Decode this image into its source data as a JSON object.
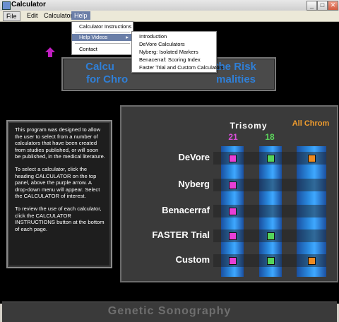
{
  "window": {
    "title": "Calculator"
  },
  "menubar": {
    "items": [
      "File",
      "Edit",
      "Calculator",
      "Help"
    ]
  },
  "help_menu": {
    "items": [
      "Calculator Instructions",
      "Help Videos",
      "Contact"
    ],
    "submenu_arrow": "▸"
  },
  "help_videos_submenu": {
    "items": [
      "Introduction",
      "DeVore Calculators",
      "Nyberg: Isolated Markers",
      "Benacerraf: Scoring Index",
      "Faster Trial and Custom Calculators"
    ]
  },
  "banner": {
    "line1": "Calcu",
    "line1_tail": "te the Risk",
    "line2": "for Chro",
    "line2_tail": "malities"
  },
  "info_panel": {
    "paragraphs": [
      "This program was designed to allow the user to select from a number of calculators that have been created from studies published, or will soon be published, in the medical literature.",
      "To select a calculator, click the heading CALCULATOR on the top panel, above the purple arrow. A drop-down menu will appear. Select the CALCULATOR of interest.",
      "To review the use of each calculator, click the CALCULATOR INSTRUCTIONS button at the bottom of each page."
    ]
  },
  "grid": {
    "header_trisomy": "Trisomy",
    "header_21": "21",
    "header_18": "18",
    "header_all": "All Chrom",
    "rows": [
      {
        "label": "DeVore",
        "c21": true,
        "c18": true,
        "all": true
      },
      {
        "label": "Nyberg",
        "c21": true,
        "c18": false,
        "all": false
      },
      {
        "label": "Benacerraf",
        "c21": true,
        "c18": false,
        "all": false
      },
      {
        "label": "FASTER Trial",
        "c21": true,
        "c18": true,
        "all": false
      },
      {
        "label": "Custom",
        "c21": true,
        "c18": true,
        "all": true
      }
    ],
    "colors": {
      "c21": "#e83fd6",
      "c18": "#55d45a",
      "all": "#ee8a1f"
    }
  },
  "footer": {
    "text": "Genetic Sonography"
  }
}
